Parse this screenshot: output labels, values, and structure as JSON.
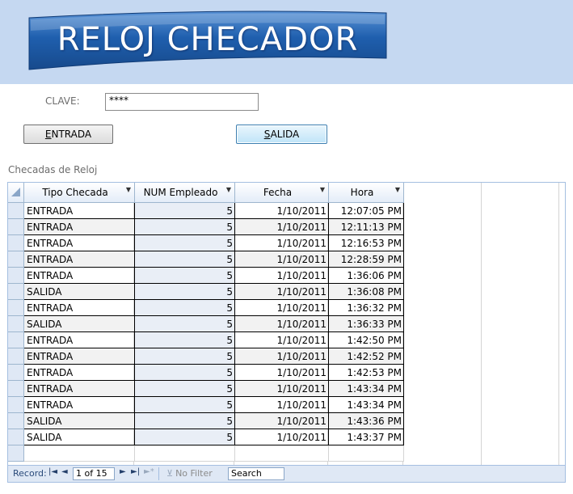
{
  "banner": {
    "title": "RELOJ CHECADOR"
  },
  "clave": {
    "label": "CLAVE:",
    "value": "****"
  },
  "buttons": {
    "entrada": "NTRADA",
    "entrada_hotkey": "E",
    "salida": "ALIDA",
    "salida_hotkey": "S"
  },
  "section_label": "Checadas de Reloj",
  "table": {
    "columns": [
      "Tipo Checada",
      "NUM Empleado",
      "Fecha",
      "Hora"
    ],
    "rows": [
      [
        "ENTRADA",
        "5",
        "1/10/2011",
        "12:07:05 PM"
      ],
      [
        "ENTRADA",
        "5",
        "1/10/2011",
        "12:11:13 PM"
      ],
      [
        "ENTRADA",
        "5",
        "1/10/2011",
        "12:16:53 PM"
      ],
      [
        "ENTRADA",
        "5",
        "1/10/2011",
        "12:28:59 PM"
      ],
      [
        "ENTRADA",
        "5",
        "1/10/2011",
        "1:36:06 PM"
      ],
      [
        "SALIDA",
        "5",
        "1/10/2011",
        "1:36:08 PM"
      ],
      [
        "ENTRADA",
        "5",
        "1/10/2011",
        "1:36:32 PM"
      ],
      [
        "SALIDA",
        "5",
        "1/10/2011",
        "1:36:33 PM"
      ],
      [
        "ENTRADA",
        "5",
        "1/10/2011",
        "1:42:50 PM"
      ],
      [
        "ENTRADA",
        "5",
        "1/10/2011",
        "1:42:52 PM"
      ],
      [
        "ENTRADA",
        "5",
        "1/10/2011",
        "1:42:53 PM"
      ],
      [
        "ENTRADA",
        "5",
        "1/10/2011",
        "1:43:34 PM"
      ],
      [
        "ENTRADA",
        "5",
        "1/10/2011",
        "1:43:34 PM"
      ],
      [
        "SALIDA",
        "5",
        "1/10/2011",
        "1:43:36 PM"
      ],
      [
        "SALIDA",
        "5",
        "1/10/2011",
        "1:43:37 PM"
      ]
    ]
  },
  "navigation": {
    "record_label": "Record:",
    "position": "1 of 15",
    "filter_label": "No Filter",
    "search_label": "Search"
  },
  "colors": {
    "header_band": "#c5d8f1",
    "banner": "#1f5fae",
    "nav_bar": "#dfe8f5"
  }
}
